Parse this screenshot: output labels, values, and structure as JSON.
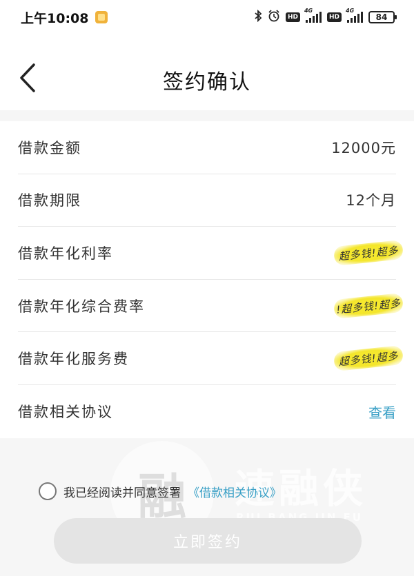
{
  "status_bar": {
    "time": "上午10:08",
    "hd_label": "HD",
    "signal_label": "4G",
    "battery": "84",
    "icons": [
      "note-icon",
      "bluetooth-icon",
      "alarm-icon",
      "signal-icon",
      "battery-icon"
    ]
  },
  "header": {
    "title": "签约确认",
    "back_icon": "chevron-left-icon"
  },
  "details": {
    "rows": [
      {
        "label": "借款金额",
        "value": "12000元"
      },
      {
        "label": "借款期限",
        "value": "12个月"
      },
      {
        "label": "借款年化利率",
        "value": ""
      },
      {
        "label": "借款年化综合费率",
        "value": ""
      },
      {
        "label": "借款年化服务费",
        "value": ""
      },
      {
        "label": "借款相关协议",
        "link": "查看"
      }
    ],
    "redaction_overlays": [
      "超多钱!超多",
      "!超多钱!超多",
      "超多钱!超多"
    ],
    "link_color": "#3aa0c6",
    "redaction_color": "#f4e62c"
  },
  "agreement": {
    "text": "我已经阅读并同意签署",
    "link": "《借款相关协议》",
    "checked": false
  },
  "submit": {
    "label": "立即签约",
    "enabled": false
  },
  "watermark": {
    "text": "速融侠",
    "sub": "RUI BANG JIN FU",
    "glyph": "融"
  }
}
